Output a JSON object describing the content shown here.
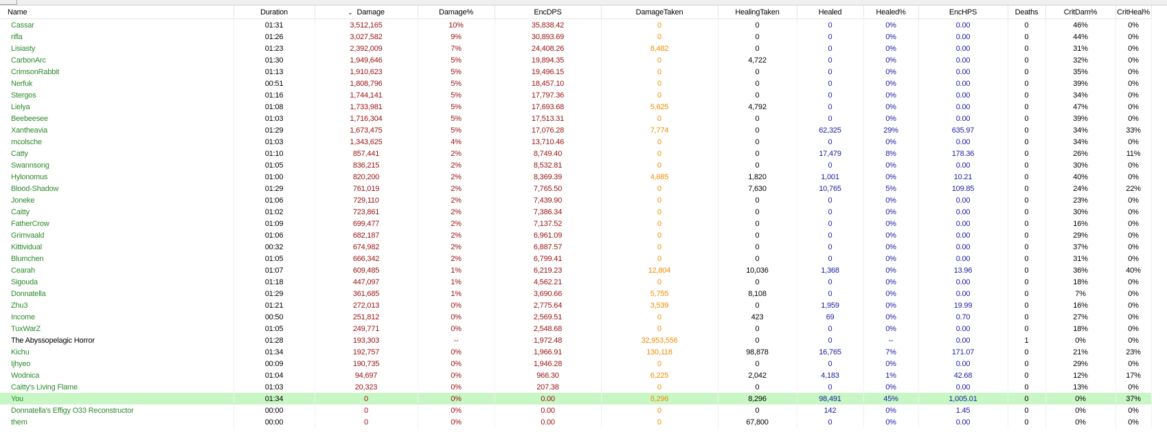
{
  "columns": [
    {
      "key": "name",
      "label": "Name"
    },
    {
      "key": "duration",
      "label": "Duration"
    },
    {
      "key": "damage",
      "label": "Damage",
      "sort_indicator": "⌄"
    },
    {
      "key": "damage_pct",
      "label": "Damage%"
    },
    {
      "key": "encdps",
      "label": "EncDPS"
    },
    {
      "key": "damage_taken",
      "label": "DamageTaken"
    },
    {
      "key": "healing_taken",
      "label": "HealingTaken"
    },
    {
      "key": "healed",
      "label": "Healed"
    },
    {
      "key": "healed_pct",
      "label": "Healed%"
    },
    {
      "key": "enchps",
      "label": "EncHPS"
    },
    {
      "key": "deaths",
      "label": "Deaths"
    },
    {
      "key": "critdam",
      "label": "CritDam%"
    },
    {
      "key": "critheal",
      "label": "CritHeal%"
    }
  ],
  "rows": [
    [
      "Cassar",
      "01:31",
      "3,512,165",
      "10%",
      "35,838.42",
      "0",
      "0",
      "0",
      "0%",
      "0.00",
      "0",
      "46%",
      "0%"
    ],
    [
      "rifla",
      "01:26",
      "3,027,582",
      "9%",
      "30,893.69",
      "0",
      "0",
      "0",
      "0%",
      "0.00",
      "0",
      "44%",
      "0%"
    ],
    [
      "Lisiasty",
      "01:23",
      "2,392,009",
      "7%",
      "24,408.26",
      "8,482",
      "0",
      "0",
      "0%",
      "0.00",
      "0",
      "31%",
      "0%"
    ],
    [
      "CarbonArc",
      "01:30",
      "1,949,646",
      "5%",
      "19,894.35",
      "0",
      "4,722",
      "0",
      "0%",
      "0.00",
      "0",
      "32%",
      "0%"
    ],
    [
      "CrimsonRabbit",
      "01:13",
      "1,910,623",
      "5%",
      "19,496.15",
      "0",
      "0",
      "0",
      "0%",
      "0.00",
      "0",
      "35%",
      "0%"
    ],
    [
      "Nerfuk",
      "00:51",
      "1,808,796",
      "5%",
      "18,457.10",
      "0",
      "0",
      "0",
      "0%",
      "0.00",
      "0",
      "39%",
      "0%"
    ],
    [
      "Stergos",
      "01:16",
      "1,744,141",
      "5%",
      "17,797.36",
      "0",
      "0",
      "0",
      "0%",
      "0.00",
      "0",
      "34%",
      "0%"
    ],
    [
      "Lielya",
      "01:08",
      "1,733,981",
      "5%",
      "17,693.68",
      "5,625",
      "4,792",
      "0",
      "0%",
      "0.00",
      "0",
      "47%",
      "0%"
    ],
    [
      "Beebeesee",
      "01:03",
      "1,716,304",
      "5%",
      "17,513.31",
      "0",
      "0",
      "0",
      "0%",
      "0.00",
      "0",
      "39%",
      "0%"
    ],
    [
      "Xantheavia",
      "01:29",
      "1,673,475",
      "5%",
      "17,076.28",
      "7,774",
      "0",
      "62,325",
      "29%",
      "635.97",
      "0",
      "34%",
      "33%"
    ],
    [
      "mcolsche",
      "01:03",
      "1,343,625",
      "4%",
      "13,710.46",
      "0",
      "0",
      "0",
      "0%",
      "0.00",
      "0",
      "34%",
      "0%"
    ],
    [
      "Catty",
      "01:10",
      "857,441",
      "2%",
      "8,749.40",
      "0",
      "0",
      "17,479",
      "8%",
      "178.36",
      "0",
      "26%",
      "11%"
    ],
    [
      "Swannsong",
      "01:05",
      "836,215",
      "2%",
      "8,532.81",
      "0",
      "0",
      "0",
      "0%",
      "0.00",
      "0",
      "30%",
      "0%"
    ],
    [
      "Hylonomus",
      "01:00",
      "820,200",
      "2%",
      "8,369.39",
      "4,685",
      "1,820",
      "1,001",
      "0%",
      "10.21",
      "0",
      "40%",
      "0%"
    ],
    [
      "Blood-Shadow",
      "01:29",
      "761,019",
      "2%",
      "7,765.50",
      "0",
      "7,630",
      "10,765",
      "5%",
      "109.85",
      "0",
      "24%",
      "22%"
    ],
    [
      "Joneke",
      "01:06",
      "729,110",
      "2%",
      "7,439.90",
      "0",
      "0",
      "0",
      "0%",
      "0.00",
      "0",
      "23%",
      "0%"
    ],
    [
      "Caitty",
      "01:02",
      "723,861",
      "2%",
      "7,386.34",
      "0",
      "0",
      "0",
      "0%",
      "0.00",
      "0",
      "30%",
      "0%"
    ],
    [
      "FatherCrow",
      "01:09",
      "699,477",
      "2%",
      "7,137.52",
      "0",
      "0",
      "0",
      "0%",
      "0.00",
      "0",
      "16%",
      "0%"
    ],
    [
      "Grimvaald",
      "01:06",
      "682,187",
      "2%",
      "6,961.09",
      "0",
      "0",
      "0",
      "0%",
      "0.00",
      "0",
      "29%",
      "0%"
    ],
    [
      "Kittividual",
      "00:32",
      "674,982",
      "2%",
      "6,887.57",
      "0",
      "0",
      "0",
      "0%",
      "0.00",
      "0",
      "37%",
      "0%"
    ],
    [
      "Blumchen",
      "01:05",
      "666,342",
      "2%",
      "6,799.41",
      "0",
      "0",
      "0",
      "0%",
      "0.00",
      "0",
      "31%",
      "0%"
    ],
    [
      "Cearah",
      "01:07",
      "609,485",
      "1%",
      "6,219.23",
      "12,804",
      "10,036",
      "1,368",
      "0%",
      "13.96",
      "0",
      "36%",
      "40%"
    ],
    [
      "Sigouda",
      "01:18",
      "447,097",
      "1%",
      "4,562.21",
      "0",
      "0",
      "0",
      "0%",
      "0.00",
      "0",
      "18%",
      "0%"
    ],
    [
      "Donnatella",
      "01:29",
      "361,685",
      "1%",
      "3,690.66",
      "5,755",
      "8,108",
      "0",
      "0%",
      "0.00",
      "0",
      "7%",
      "0%"
    ],
    [
      "Zhu3",
      "01:21",
      "272,013",
      "0%",
      "2,775.64",
      "3,539",
      "0",
      "1,959",
      "0%",
      "19.99",
      "0",
      "16%",
      "0%"
    ],
    [
      "Income",
      "00:50",
      "251,812",
      "0%",
      "2,569.51",
      "0",
      "423",
      "69",
      "0%",
      "0.70",
      "0",
      "27%",
      "0%"
    ],
    [
      "TuxWarZ",
      "01:05",
      "249,771",
      "0%",
      "2,548.68",
      "0",
      "0",
      "0",
      "0%",
      "0.00",
      "0",
      "18%",
      "0%"
    ],
    [
      "The Abyssopelagic Horror",
      "01:28",
      "193,303",
      "--",
      "1,972.48",
      "32,953,556",
      "0",
      "0",
      "--",
      "0.00",
      "1",
      "0%",
      "0%"
    ],
    [
      "Kichu",
      "01:34",
      "192,757",
      "0%",
      "1,966.91",
      "130,118",
      "98,878",
      "16,765",
      "7%",
      "171.07",
      "0",
      "21%",
      "23%"
    ],
    [
      "Ijhyeo",
      "00:09",
      "190,735",
      "0%",
      "1,946.28",
      "0",
      "0",
      "0",
      "0%",
      "0.00",
      "0",
      "29%",
      "0%"
    ],
    [
      "Wodnica",
      "01:04",
      "94,697",
      "0%",
      "966.30",
      "6,225",
      "2,042",
      "4,183",
      "1%",
      "42.68",
      "0",
      "12%",
      "17%"
    ],
    [
      "Caitty's Living Flame",
      "01:03",
      "20,323",
      "0%",
      "207.38",
      "0",
      "0",
      "0",
      "0%",
      "0.00",
      "0",
      "13%",
      "0%"
    ],
    [
      "You",
      "01:34",
      "0",
      "0%",
      "0.00",
      "8,296",
      "8,296",
      "98,491",
      "45%",
      "1,005.01",
      "0",
      "0%",
      "37%"
    ],
    [
      "Donnatella's Effigy O33 Reconstructor",
      "00:00",
      "0",
      "0%",
      "0.00",
      "0",
      "0",
      "142",
      "0%",
      "1.45",
      "0",
      "0%",
      "0%"
    ],
    [
      "them",
      "00:00",
      "0",
      "0%",
      "0.00",
      "0",
      "67,800",
      "0",
      "0%",
      "0.00",
      "0",
      "0%",
      "0%"
    ]
  ],
  "highlight_row_name": "You",
  "black_name_rows": [
    "The Abyssopelagic Horror"
  ],
  "colors": {
    "name_green": "#2b8a2b",
    "damage_red": "#9a1010",
    "taken_orange": "#f08c00",
    "healed_blue": "#1a1aa0",
    "highlight_bg": "#c8f7c5"
  }
}
